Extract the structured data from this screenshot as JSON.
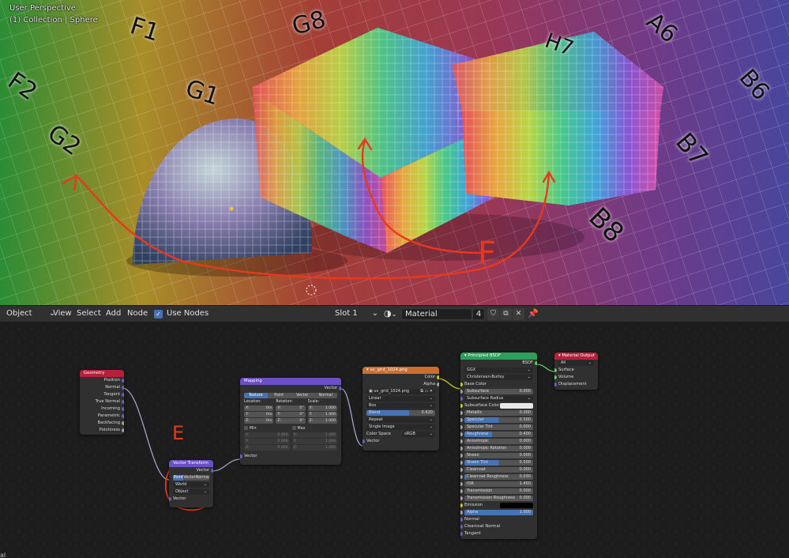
{
  "viewport": {
    "perspective_label": "User Perspective",
    "collection_label": "(1) Collection | Sphere",
    "grid_labels": [
      "F1",
      "F2",
      "G1",
      "G2",
      "G8",
      "H7",
      "A6",
      "B6",
      "B7",
      "B8"
    ],
    "annotation_F": "F",
    "annotation_E": "E",
    "annotation_color": "#e8391d"
  },
  "header": {
    "mode": "Object",
    "menus": [
      "View",
      "Select",
      "Add",
      "Node"
    ],
    "use_nodes_label": "Use Nodes",
    "slot": "Slot 1",
    "material_name": "Material",
    "user_count": "4"
  },
  "nodes": {
    "geometry": {
      "title": "Geometry",
      "outputs": [
        "Position",
        "Normal",
        "Tangent",
        "True Normal",
        "Incoming",
        "Parametric",
        "Backfacing",
        "Pointiness"
      ]
    },
    "vector_transform": {
      "title": "Vector Transform",
      "output": "Vector",
      "type_options": [
        "Point",
        "Vector",
        "Normal"
      ],
      "convert_from": "World",
      "convert_to": "Object",
      "input": "Vector"
    },
    "mapping": {
      "title": "Mapping",
      "output": "Vector",
      "type_options": [
        "Texture",
        "Point",
        "Vector",
        "Normal"
      ],
      "location_label": "Location:",
      "rotation_label": "Rotation:",
      "scale_label": "Scale:",
      "location": [
        [
          "X:",
          "0m"
        ],
        [
          "Y:",
          "0m"
        ],
        [
          "Z:",
          "0m"
        ]
      ],
      "rotation": [
        [
          "X:",
          "0°"
        ],
        [
          "Y:",
          "0°"
        ],
        [
          "Z:",
          "0°"
        ]
      ],
      "scale": [
        [
          "X:",
          "1.000"
        ],
        [
          "Y:",
          "1.000"
        ],
        [
          "Z:",
          "1.000"
        ]
      ],
      "min_label": "Min",
      "max_label": "Max",
      "min": [
        [
          "X:",
          "0.000"
        ],
        [
          "Y:",
          "0.000"
        ],
        [
          "Z:",
          "0.000"
        ]
      ],
      "max": [
        [
          "X:",
          "1.000"
        ],
        [
          "Y:",
          "1.000"
        ],
        [
          "Z:",
          "1.000"
        ]
      ],
      "input": "Vector"
    },
    "image_texture": {
      "title": "uv_grid_1024.png",
      "outputs": [
        "Color",
        "Alpha"
      ],
      "image_name": "uv_grid_1024.png",
      "interpolation": "Linear",
      "projection": "Box",
      "blend_label": "Blend",
      "blend_value": "0.620",
      "blend_fill": 0.62,
      "extension": "Repeat",
      "source": "Single Image",
      "color_space_label": "Color Space",
      "color_space": "sRGB",
      "input": "Vector"
    },
    "principled": {
      "title": "Principled BSDF",
      "output": "BSDF",
      "distribution": "GGX",
      "subsurface_method": "Christensen-Burley",
      "base_color_label": "Base Color",
      "rows": [
        {
          "label": "Subsurface",
          "value": "0.000",
          "fill": 0
        },
        {
          "label": "Subsurface Radius",
          "value": "",
          "fill": 0,
          "dropdown": true
        },
        {
          "label": "Subsurface Color",
          "value": "",
          "fill": 0,
          "color": "#e8e8e8"
        },
        {
          "label": "Metallic",
          "value": "0.000",
          "fill": 0
        },
        {
          "label": "Specular",
          "value": "0.500",
          "fill": 0.5
        },
        {
          "label": "Specular Tint",
          "value": "0.000",
          "fill": 0
        },
        {
          "label": "Roughness",
          "value": "0.400",
          "fill": 0.4
        },
        {
          "label": "Anisotropic",
          "value": "0.000",
          "fill": 0
        },
        {
          "label": "Anisotropic Rotation",
          "value": "0.000",
          "fill": 0
        },
        {
          "label": "Sheen",
          "value": "0.000",
          "fill": 0
        },
        {
          "label": "Sheen Tint",
          "value": "0.500",
          "fill": 0.5
        },
        {
          "label": "Clearcoat",
          "value": "0.000",
          "fill": 0
        },
        {
          "label": "Clearcoat Roughness",
          "value": "0.030",
          "fill": 0.03
        },
        {
          "label": "IOR",
          "value": "1.450",
          "fill": 0
        },
        {
          "label": "Transmission",
          "value": "0.000",
          "fill": 0
        },
        {
          "label": "Transmission Roughness",
          "value": "0.000",
          "fill": 0
        },
        {
          "label": "Emission",
          "value": "",
          "fill": 0,
          "color": "#000000"
        },
        {
          "label": "Alpha",
          "value": "1.000",
          "fill": 1
        }
      ],
      "tail_inputs": [
        "Normal",
        "Clearcoat Normal",
        "Tangent"
      ]
    },
    "material_output": {
      "title": "Material Output",
      "target": "All",
      "inputs": [
        "Surface",
        "Volume",
        "Displacement"
      ]
    }
  },
  "colors": {
    "geometry_header": "#b5213b",
    "vector_header": "#6b4fc7",
    "texture_header": "#cc6f2e",
    "shader_header": "#2ca05a",
    "output_header": "#b5213b",
    "accent": "#4772b3"
  },
  "footer_partial": "al"
}
